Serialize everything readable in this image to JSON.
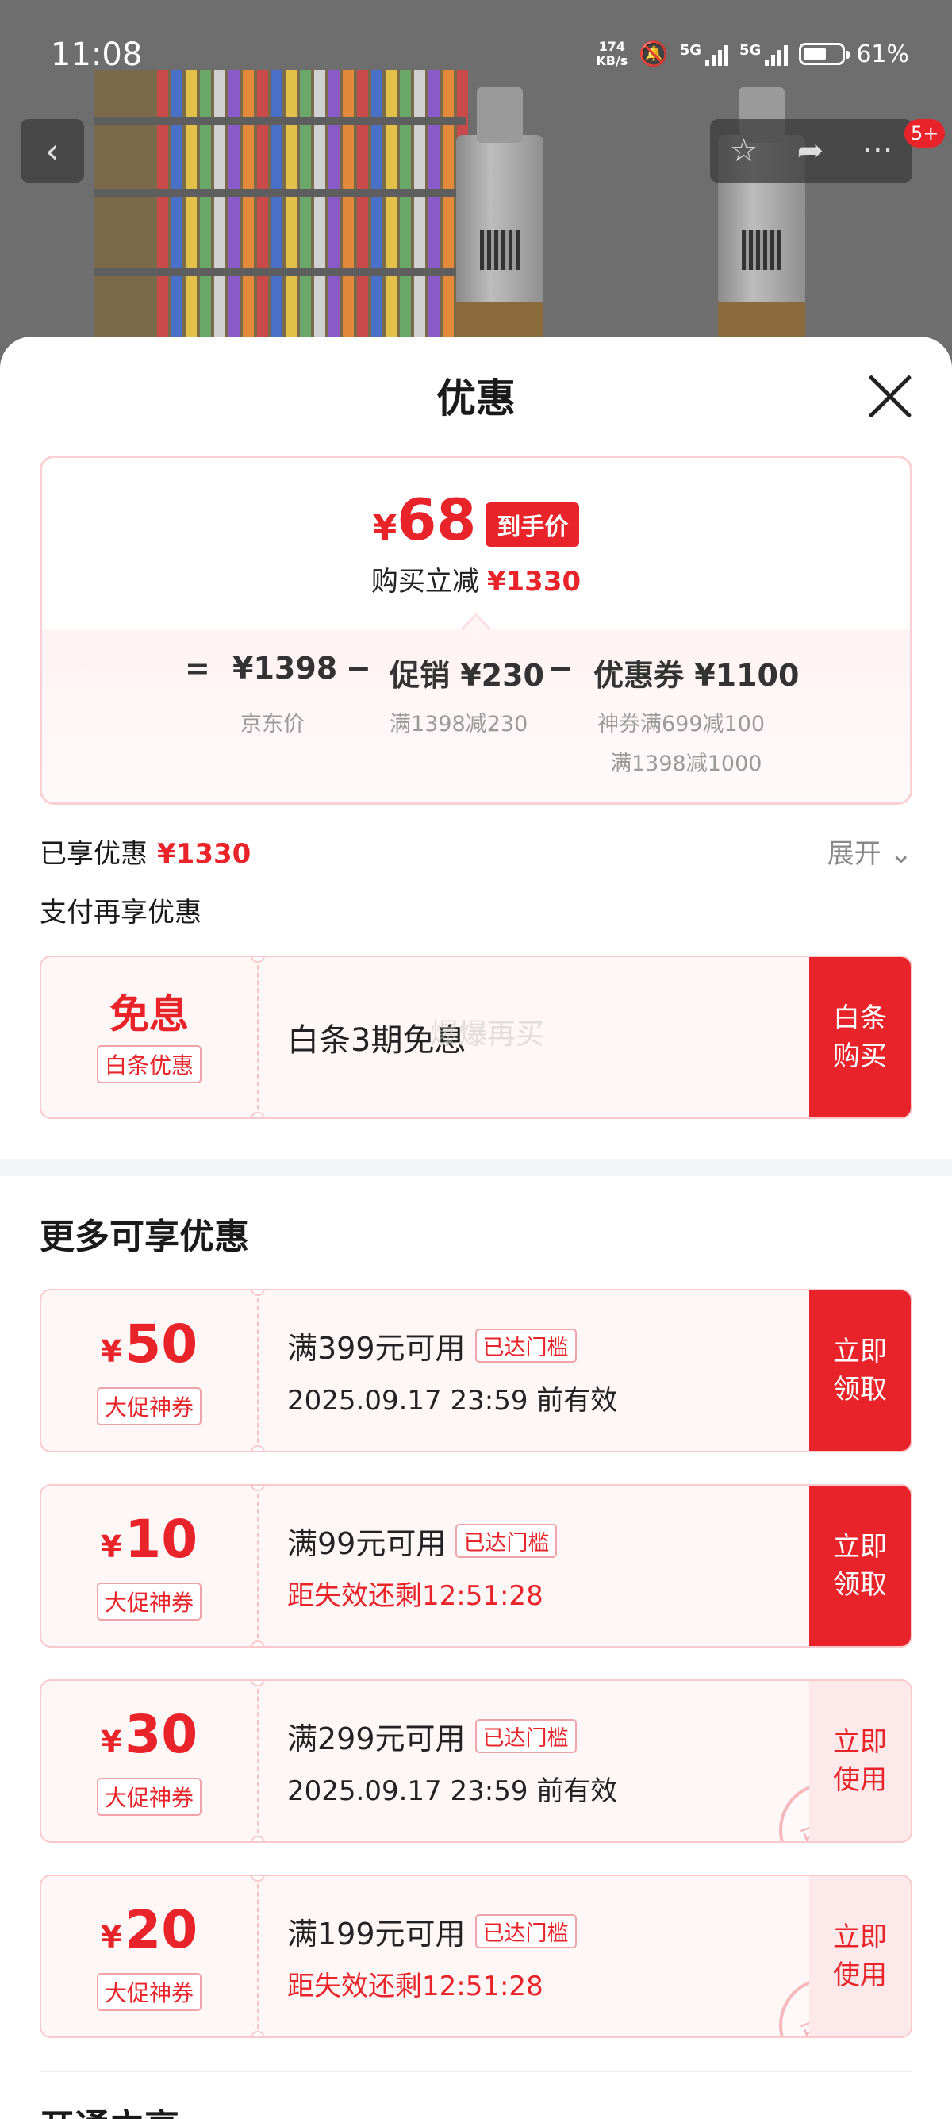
{
  "status_bar": {
    "time": "11:08",
    "net_speed_value": "174",
    "net_speed_unit": "KB/s",
    "network_1": "5G",
    "network_2": "5G",
    "battery": "61%"
  },
  "product_page": {
    "cart_badge": "5+"
  },
  "sheet": {
    "title": "优惠"
  },
  "summary": {
    "final_price": "68",
    "currency": "¥",
    "final_tag": "到手价",
    "reduce_label": "购买立减",
    "reduce_amount": "¥1330",
    "equals": "=",
    "jd_price": "¥1398",
    "jd_price_label": "京东价",
    "minus_1": "−",
    "promo_label": "促销 ¥230",
    "promo_detail": "满1398减230",
    "minus_2": "−",
    "coupon_label": "优惠券 ¥1100",
    "coupon_detail_1": "神券满699减100",
    "coupon_detail_2": "满1398减1000"
  },
  "enjoyed": {
    "label": "已享优惠",
    "amount": "¥1330",
    "expand_label": "展开"
  },
  "pay_again": {
    "title": "支付再享优惠",
    "card": {
      "headline": "免息",
      "tag": "白条优惠",
      "description": "白条3期免息",
      "watermark": "爆爆再买",
      "action": "白条购买"
    }
  },
  "more": {
    "title": "更多可享优惠",
    "coupons": [
      {
        "currency": "¥",
        "amount": "50",
        "tag": "大促神券",
        "condition": "满399元可用",
        "reached": "已达门槛",
        "validity": "2025.09.17 23:59 前有效",
        "action": "立即领取",
        "claimed": false
      },
      {
        "currency": "¥",
        "amount": "10",
        "tag": "大促神券",
        "condition": "满99元可用",
        "reached": "已达门槛",
        "validity": "距失效还剩12:51:28",
        "action": "立即领取",
        "claimed": false
      },
      {
        "currency": "¥",
        "amount": "30",
        "tag": "大促神券",
        "condition": "满299元可用",
        "reached": "已达门槛",
        "validity": "2025.09.17 23:59 前有效",
        "action": "立即使用",
        "claimed": true,
        "stamp": "已领"
      },
      {
        "currency": "¥",
        "amount": "20",
        "tag": "大促神券",
        "condition": "满199元可用",
        "reached": "已达门槛",
        "validity": "距失效还剩12:51:28",
        "action": "立即使用",
        "claimed": true,
        "stamp": "已领"
      }
    ]
  },
  "next_section": {
    "title": "开通立享"
  }
}
